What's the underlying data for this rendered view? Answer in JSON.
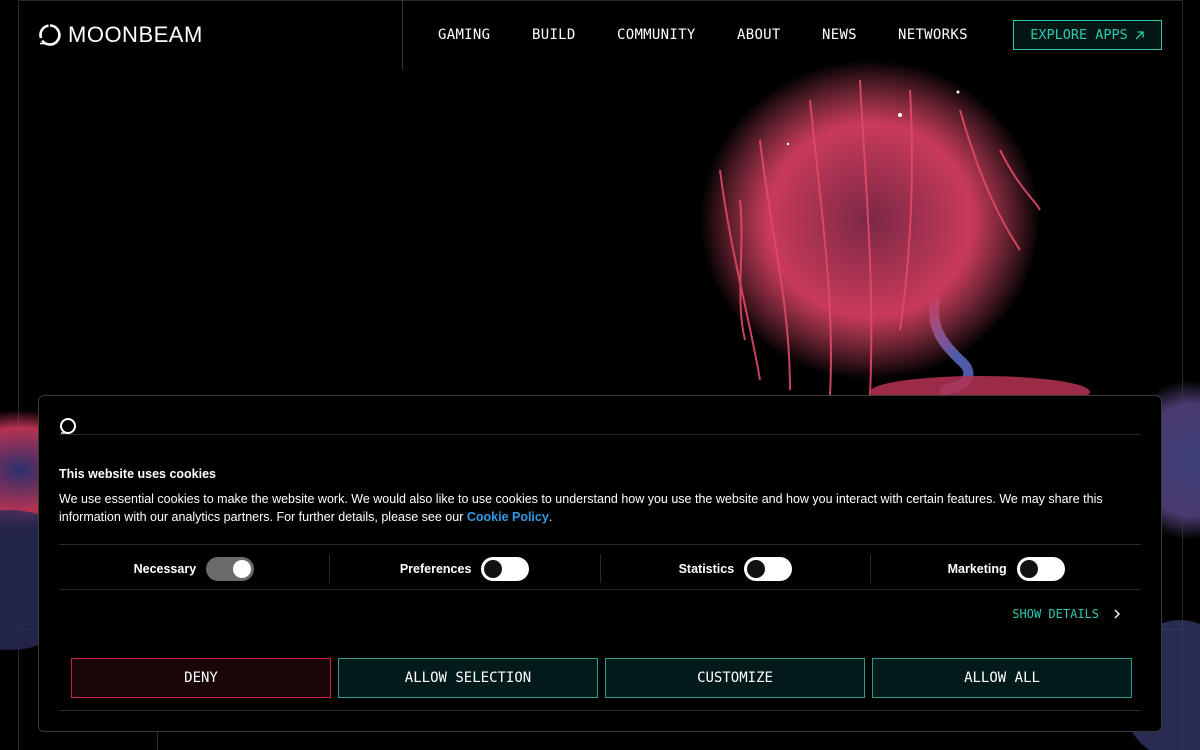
{
  "brand": {
    "name": "MOONBEAM"
  },
  "nav": {
    "items": [
      {
        "label": "GAMING"
      },
      {
        "label": "BUILD"
      },
      {
        "label": "COMMUNITY"
      },
      {
        "label": "ABOUT"
      },
      {
        "label": "NEWS"
      },
      {
        "label": "NETWORKS"
      }
    ],
    "cta": {
      "label": "EXPLORE APPS",
      "icon": "arrow-up-right-icon"
    }
  },
  "colors": {
    "accent": "#2ec9b0",
    "deny": "#d11d4b",
    "link": "#2f9be6",
    "background": "#000000"
  },
  "cookie_banner": {
    "title": "This website uses cookies",
    "body": "We use essential cookies to make the website work. We would also like to use cookies to understand how you use the website and how you interact with certain features. We may share this information with our analytics partners. For further details, please see our ",
    "policy_link": "Cookie Policy",
    "period": ".",
    "toggles": [
      {
        "label": "Necessary",
        "state": "on"
      },
      {
        "label": "Preferences",
        "state": "off"
      },
      {
        "label": "Statistics",
        "state": "off"
      },
      {
        "label": "Marketing",
        "state": "off"
      }
    ],
    "show_details": "SHOW DETAILS",
    "buttons": {
      "deny": "DENY",
      "allow_selection": "ALLOW SELECTION",
      "customize": "CUSTOMIZE",
      "allow_all": "ALLOW ALL"
    }
  }
}
